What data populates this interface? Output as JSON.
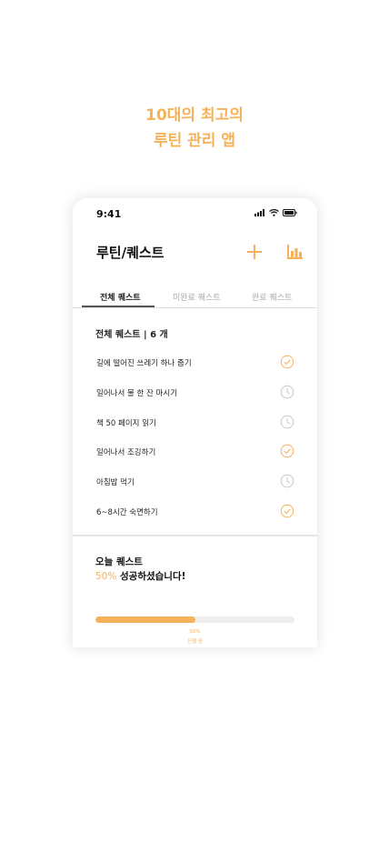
{
  "promo": {
    "line1": "10대의 최고의",
    "line2": "루틴 관리 앱"
  },
  "status_bar": {
    "time": "9:41"
  },
  "header": {
    "title": "루틴/퀘스트"
  },
  "tabs": [
    {
      "label": "전체 퀘스트",
      "active": true
    },
    {
      "label": "미완료 퀘스트",
      "active": false
    },
    {
      "label": "완료 퀘스트",
      "active": false
    }
  ],
  "quest_list": {
    "title": "전체 퀘스트 | 6 개",
    "items": [
      {
        "label": "길에 떨어진 쓰레기 하나 줍기",
        "status": "check-circle-icon"
      },
      {
        "label": "일어나서 물 한 잔 마시기",
        "status": "clock-icon"
      },
      {
        "label": "책 50 페이지 읽기",
        "status": "clock-icon"
      },
      {
        "label": "일어나서 조깅하기",
        "status": "check-circle-icon"
      },
      {
        "label": "아침밥 먹기",
        "status": "clock-icon"
      },
      {
        "label": "6~8시간 숙면하기",
        "status": "check-circle-icon"
      }
    ]
  },
  "today": {
    "title": "오늘 퀘스트",
    "percent_text": "50%",
    "message": " 성공하셨습니다!",
    "progress": 0.5,
    "progress_label": "50%",
    "progress_status": "진행 중"
  },
  "colors": {
    "accent": "#f5b25a",
    "done_icon": "#f5b25a",
    "pending_icon": "#c8c8c8"
  }
}
